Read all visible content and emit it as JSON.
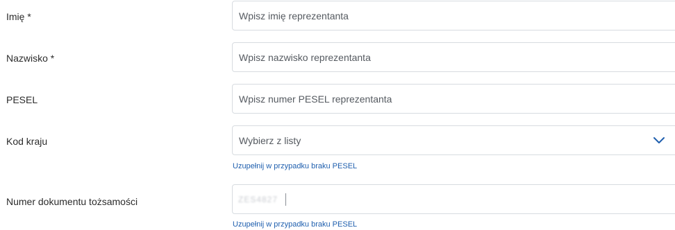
{
  "form": {
    "first_name": {
      "label": "Imię *",
      "placeholder": "Wpisz imię reprezentanta"
    },
    "last_name": {
      "label": "Nazwisko *",
      "placeholder": "Wpisz nazwisko reprezentanta"
    },
    "pesel": {
      "label": "PESEL",
      "placeholder": "Wpisz numer PESEL reprezentanta"
    },
    "country_code": {
      "label": "Kod kraju",
      "placeholder": "Wybierz z listy",
      "hint": "Uzupełnij w przypadku braku PESEL",
      "icon": "chevron-down-icon"
    },
    "id_document": {
      "label": "Numer dokumentu tożsamości",
      "value": "ZES4827",
      "hint": "Uzupełnij w przypadku braku PESEL"
    }
  },
  "colors": {
    "accent": "#1f5fae",
    "border": "#d7dbe0",
    "text": "#2b2b2b"
  }
}
